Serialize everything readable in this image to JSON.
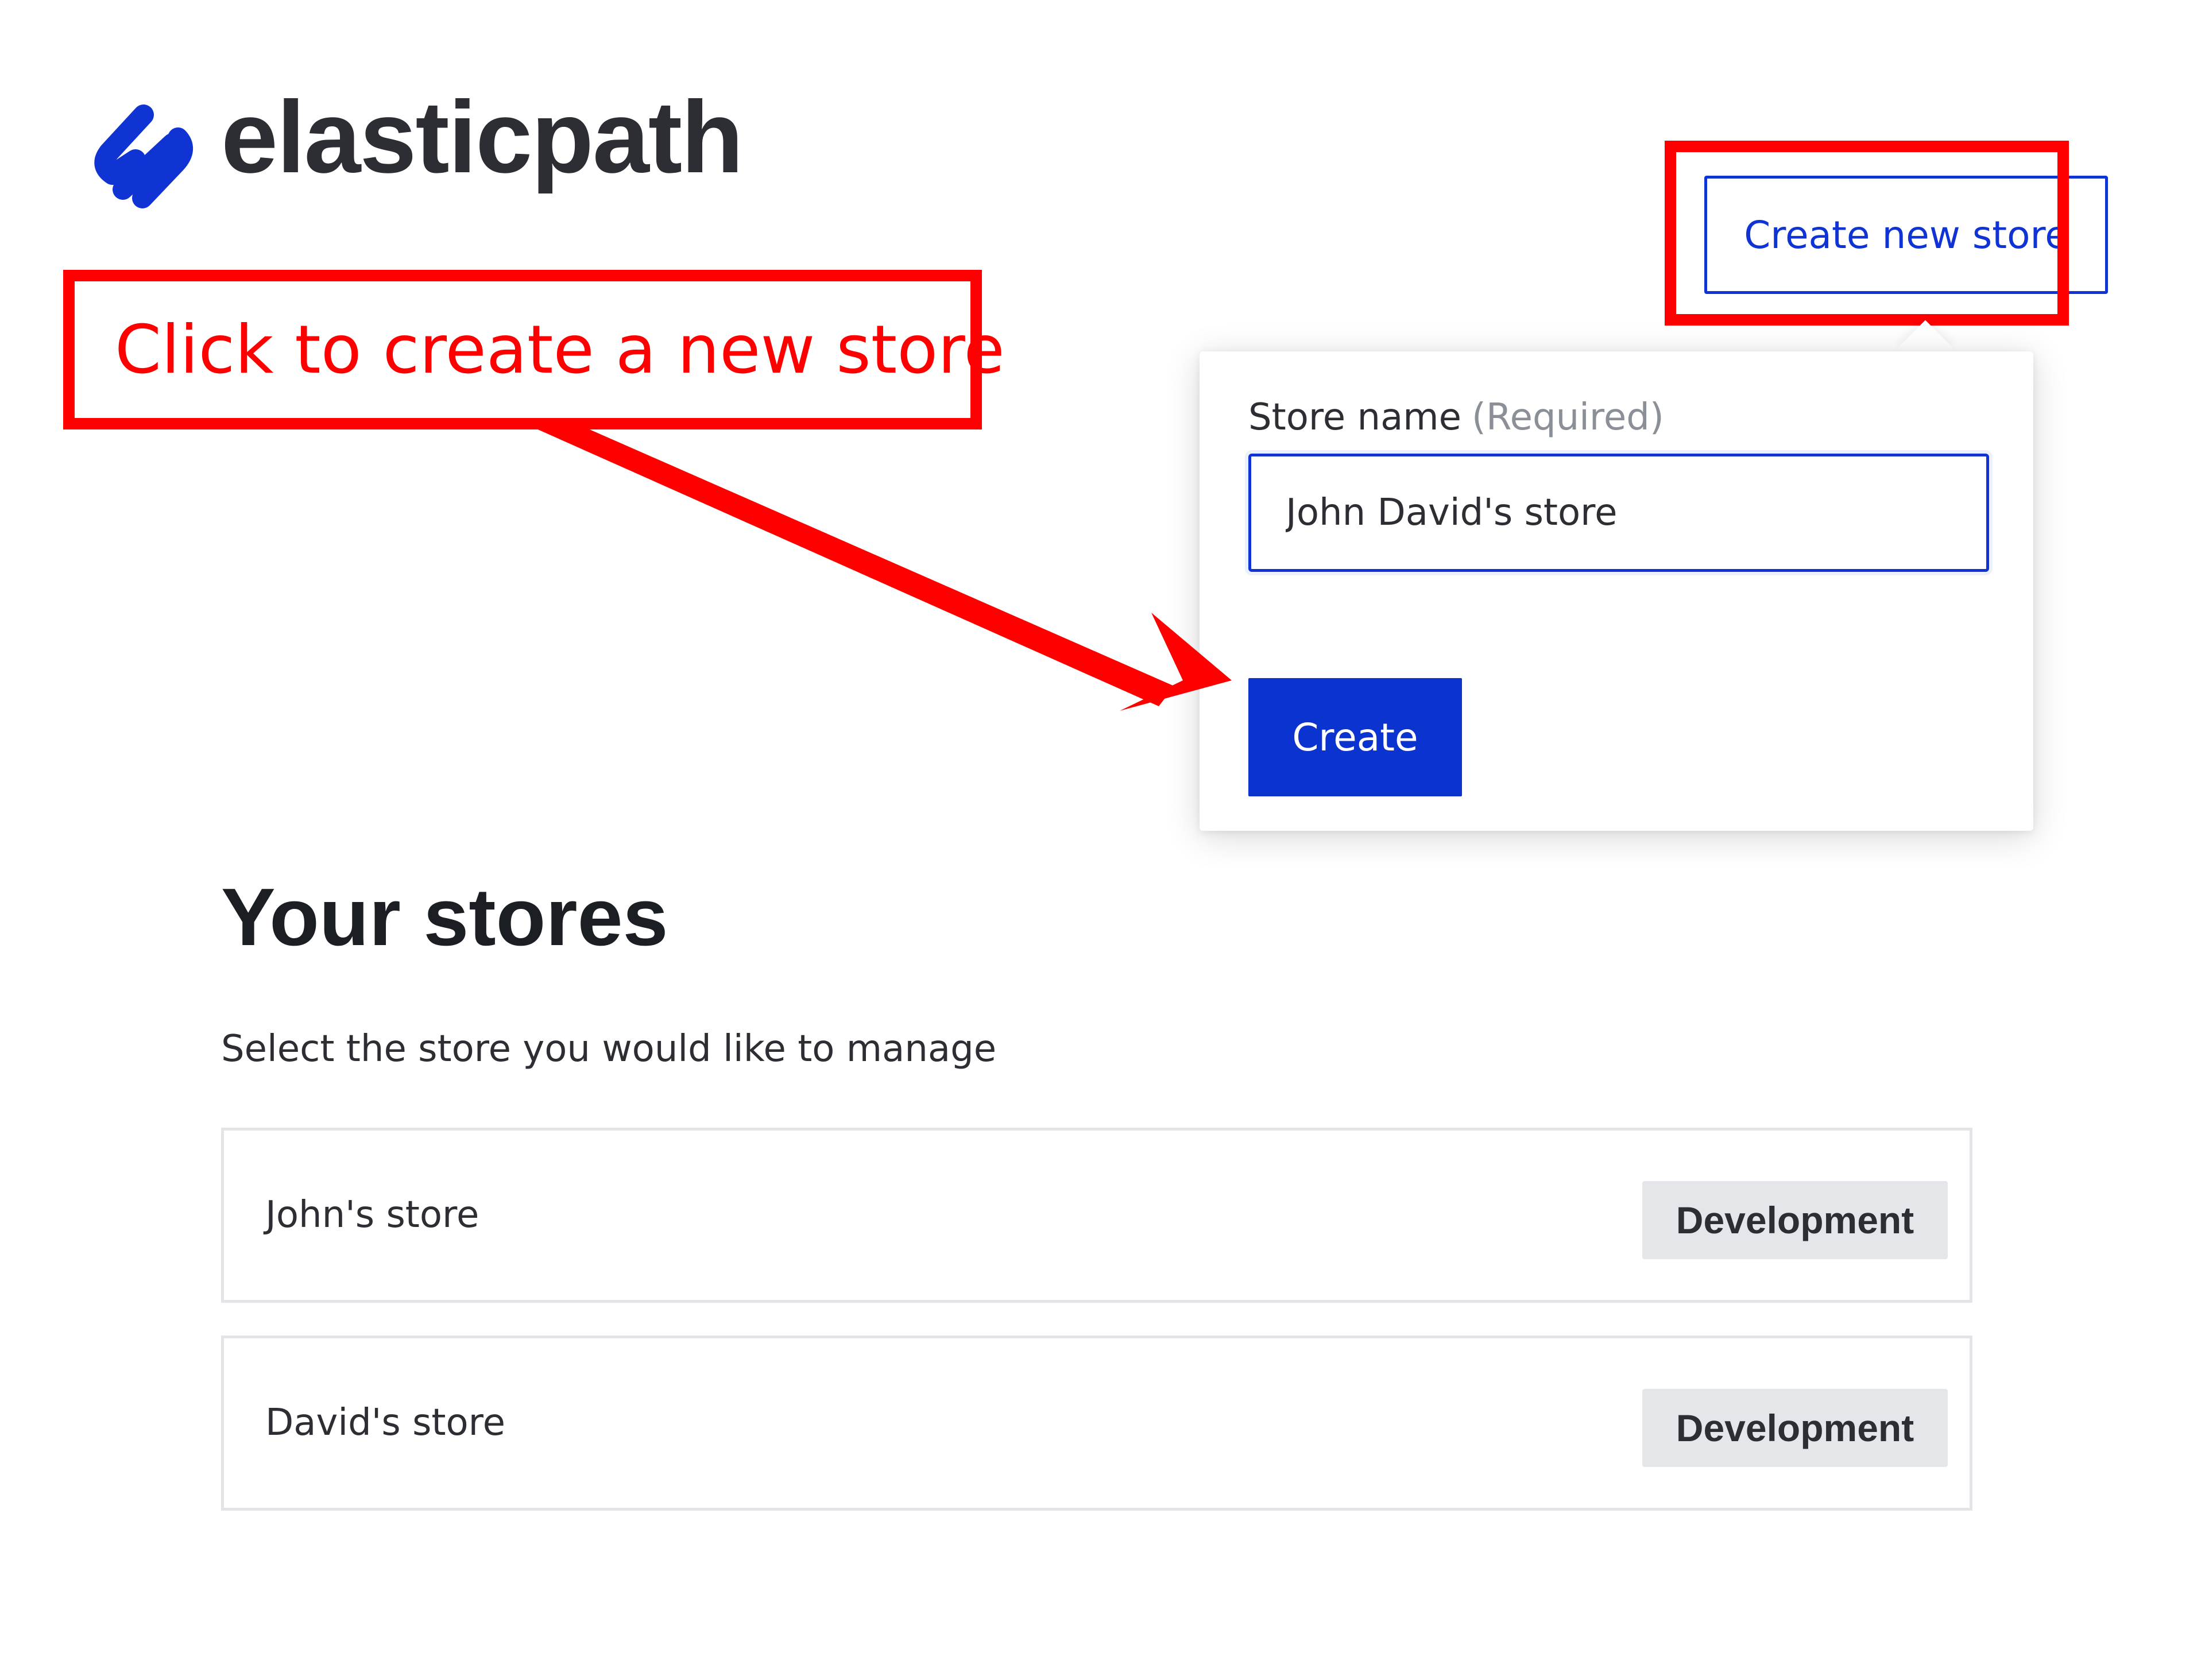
{
  "brand": {
    "name": "elasticpath",
    "logo_icon": "elasticpath-logo-icon",
    "color": "#1034d4"
  },
  "header": {
    "create_new_store_label": "Create new store"
  },
  "annotation": {
    "callout_text": "Click to create a new store",
    "highlight_color": "#ff0000"
  },
  "create_store_popover": {
    "field_label": "Store name",
    "field_required_hint": "(Required)",
    "store_name_value": "John David's store",
    "create_button_label": "Create"
  },
  "stores_section": {
    "title": "Your stores",
    "subtitle": "Select the store you would like to manage",
    "stores": [
      {
        "name": "John's store",
        "environment": "Development"
      },
      {
        "name": "David's store",
        "environment": "Development"
      }
    ]
  },
  "colors": {
    "primary": "#0b33cf",
    "badge_background": "#e4e6ea",
    "annotation_red": "#ff0000"
  }
}
